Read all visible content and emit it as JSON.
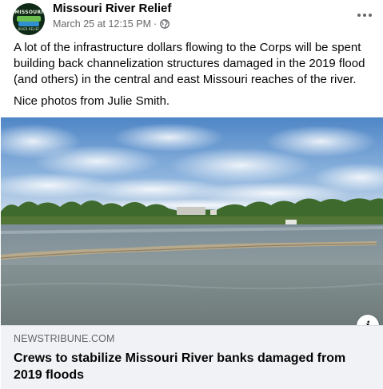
{
  "post": {
    "page_name": "Missouri River Relief",
    "avatar_text": "MISSOURI",
    "avatar_subtext": "RIVER RELIEF",
    "timestamp": "March 25 at 12:15 PM",
    "separator": "·",
    "privacy_icon": "globe-icon",
    "more_icon": "more-horizontal-icon",
    "text_paragraphs": [
      "A lot of the infrastructure dollars flowing to the Corps will be spent building back channelization structures damaged in the 2019 flood (and others) in the central and east Missouri reaches of the river.",
      "Nice photos from Julie Smith."
    ]
  },
  "link": {
    "image_icon": "river-photo",
    "info_label": "i",
    "domain": "NEWSTRIBUNE.COM",
    "title": "Crews to stabilize Missouri River banks damaged from 2019 floods"
  }
}
